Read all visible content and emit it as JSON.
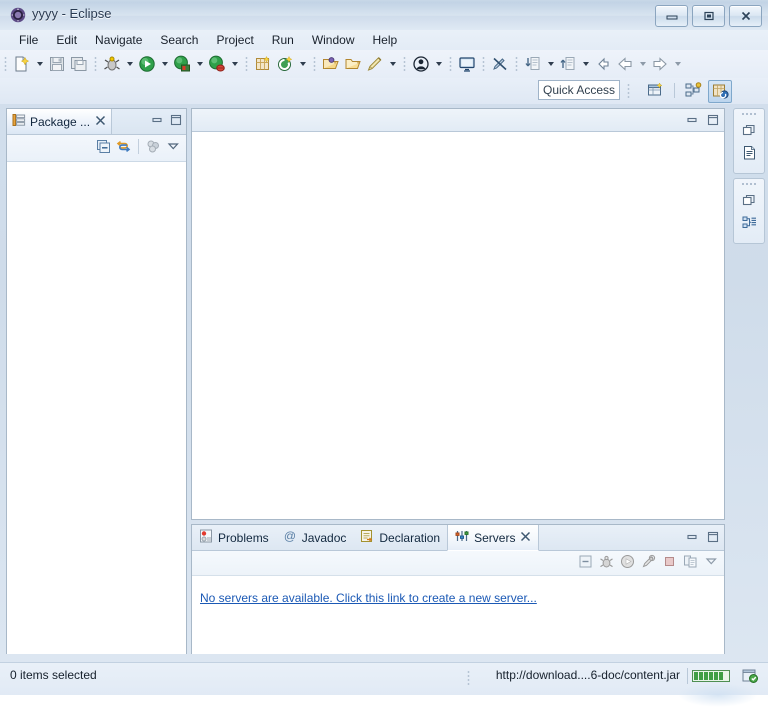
{
  "window": {
    "title": "yyyy - Eclipse",
    "app_icon": "eclipse-icon",
    "controls": {
      "minimize": "Minimize",
      "restore": "Restore",
      "close": "Close"
    }
  },
  "menubar": {
    "items": [
      {
        "label": "File"
      },
      {
        "label": "Edit"
      },
      {
        "label": "Navigate"
      },
      {
        "label": "Search"
      },
      {
        "label": "Project"
      },
      {
        "label": "Run"
      },
      {
        "label": "Window"
      },
      {
        "label": "Help"
      }
    ]
  },
  "toolbar": {
    "groups": [
      {
        "items": [
          {
            "name": "new-wizard-icon",
            "has_dropdown": true
          },
          {
            "name": "save-icon",
            "has_dropdown": false
          },
          {
            "name": "save-all-icon",
            "has_dropdown": false
          }
        ]
      },
      {
        "items": [
          {
            "name": "debug-icon",
            "has_dropdown": true
          },
          {
            "name": "run-icon",
            "has_dropdown": true
          },
          {
            "name": "run-on-server-icon",
            "has_dropdown": true
          },
          {
            "name": "debug-on-server-icon",
            "has_dropdown": true
          }
        ]
      },
      {
        "items": [
          {
            "name": "new-java-project-icon",
            "has_dropdown": false
          },
          {
            "name": "new-java-class-icon",
            "has_dropdown": true
          }
        ]
      },
      {
        "items": [
          {
            "name": "open-type-icon",
            "has_dropdown": false
          },
          {
            "name": "open-task-icon",
            "has_dropdown": false
          },
          {
            "name": "new-annotation-icon",
            "has_dropdown": true
          }
        ]
      },
      {
        "items": [
          {
            "name": "person-icon",
            "has_dropdown": true
          }
        ]
      },
      {
        "items": [
          {
            "name": "console-icon",
            "has_dropdown": false
          }
        ]
      },
      {
        "items": [
          {
            "name": "toggle-mark-occurrences-icon",
            "has_dropdown": false
          }
        ]
      },
      {
        "items": [
          {
            "name": "next-annotation-icon",
            "has_dropdown": true
          },
          {
            "name": "previous-annotation-icon",
            "has_dropdown": true
          },
          {
            "name": "last-edit-location-icon",
            "has_dropdown": false
          },
          {
            "name": "back-icon",
            "has_dropdown": true
          },
          {
            "name": "forward-icon",
            "has_dropdown": true
          }
        ]
      }
    ]
  },
  "quick_access": {
    "placeholder": "Quick Access",
    "value": "",
    "perspective_buttons": [
      {
        "name": "open-perspective-icon"
      },
      {
        "name": "perspective-java-ee-icon"
      },
      {
        "name": "perspective-java-icon",
        "selected": true
      }
    ]
  },
  "package_explorer": {
    "tab_label": "Package ...",
    "tab_icon": "package-explorer-icon",
    "close_icon": "close-icon",
    "minimize_icon": "minimize-icon",
    "maximize_icon": "maximize-icon",
    "toolbar": [
      {
        "name": "collapse-all-icon"
      },
      {
        "name": "link-with-editor-icon"
      },
      {
        "name": "view-filters-icon"
      },
      {
        "name": "view-menu-icon"
      }
    ],
    "tree_items": []
  },
  "editor_area": {
    "tabs": [],
    "minimize_icon": "minimize-icon",
    "maximize_icon": "maximize-icon"
  },
  "bottom_panel": {
    "tabs": [
      {
        "label": "Problems",
        "icon": "problems-icon",
        "active": false
      },
      {
        "label": "Javadoc",
        "icon": "javadoc-icon",
        "active": false
      },
      {
        "label": "Declaration",
        "icon": "declaration-icon",
        "active": false
      },
      {
        "label": "Servers",
        "icon": "servers-icon",
        "active": true,
        "close_icon": "close-icon"
      }
    ],
    "minimize_icon": "minimize-icon",
    "maximize_icon": "maximize-icon",
    "toolbar": [
      {
        "name": "collapse-all-icon"
      },
      {
        "name": "debug-server-icon"
      },
      {
        "name": "start-server-icon"
      },
      {
        "name": "profile-server-icon"
      },
      {
        "name": "stop-server-icon"
      },
      {
        "name": "publish-server-icon"
      },
      {
        "name": "view-menu-icon"
      }
    ],
    "empty_message": "No servers are available. Click this link to create a new server..."
  },
  "right_stacks": [
    {
      "restore_icon": "restore-icon",
      "view_icon": "outline-view-icon"
    },
    {
      "restore_icon": "restore-icon",
      "view_icon": "task-list-view-icon"
    }
  ],
  "statusbar": {
    "selection_text": "0 items selected",
    "download_text": "http://download....6-doc/content.jar",
    "progress_segments": 6,
    "progress_icon": "progress-indicator-icon",
    "progress_color": "#3f9e44"
  }
}
